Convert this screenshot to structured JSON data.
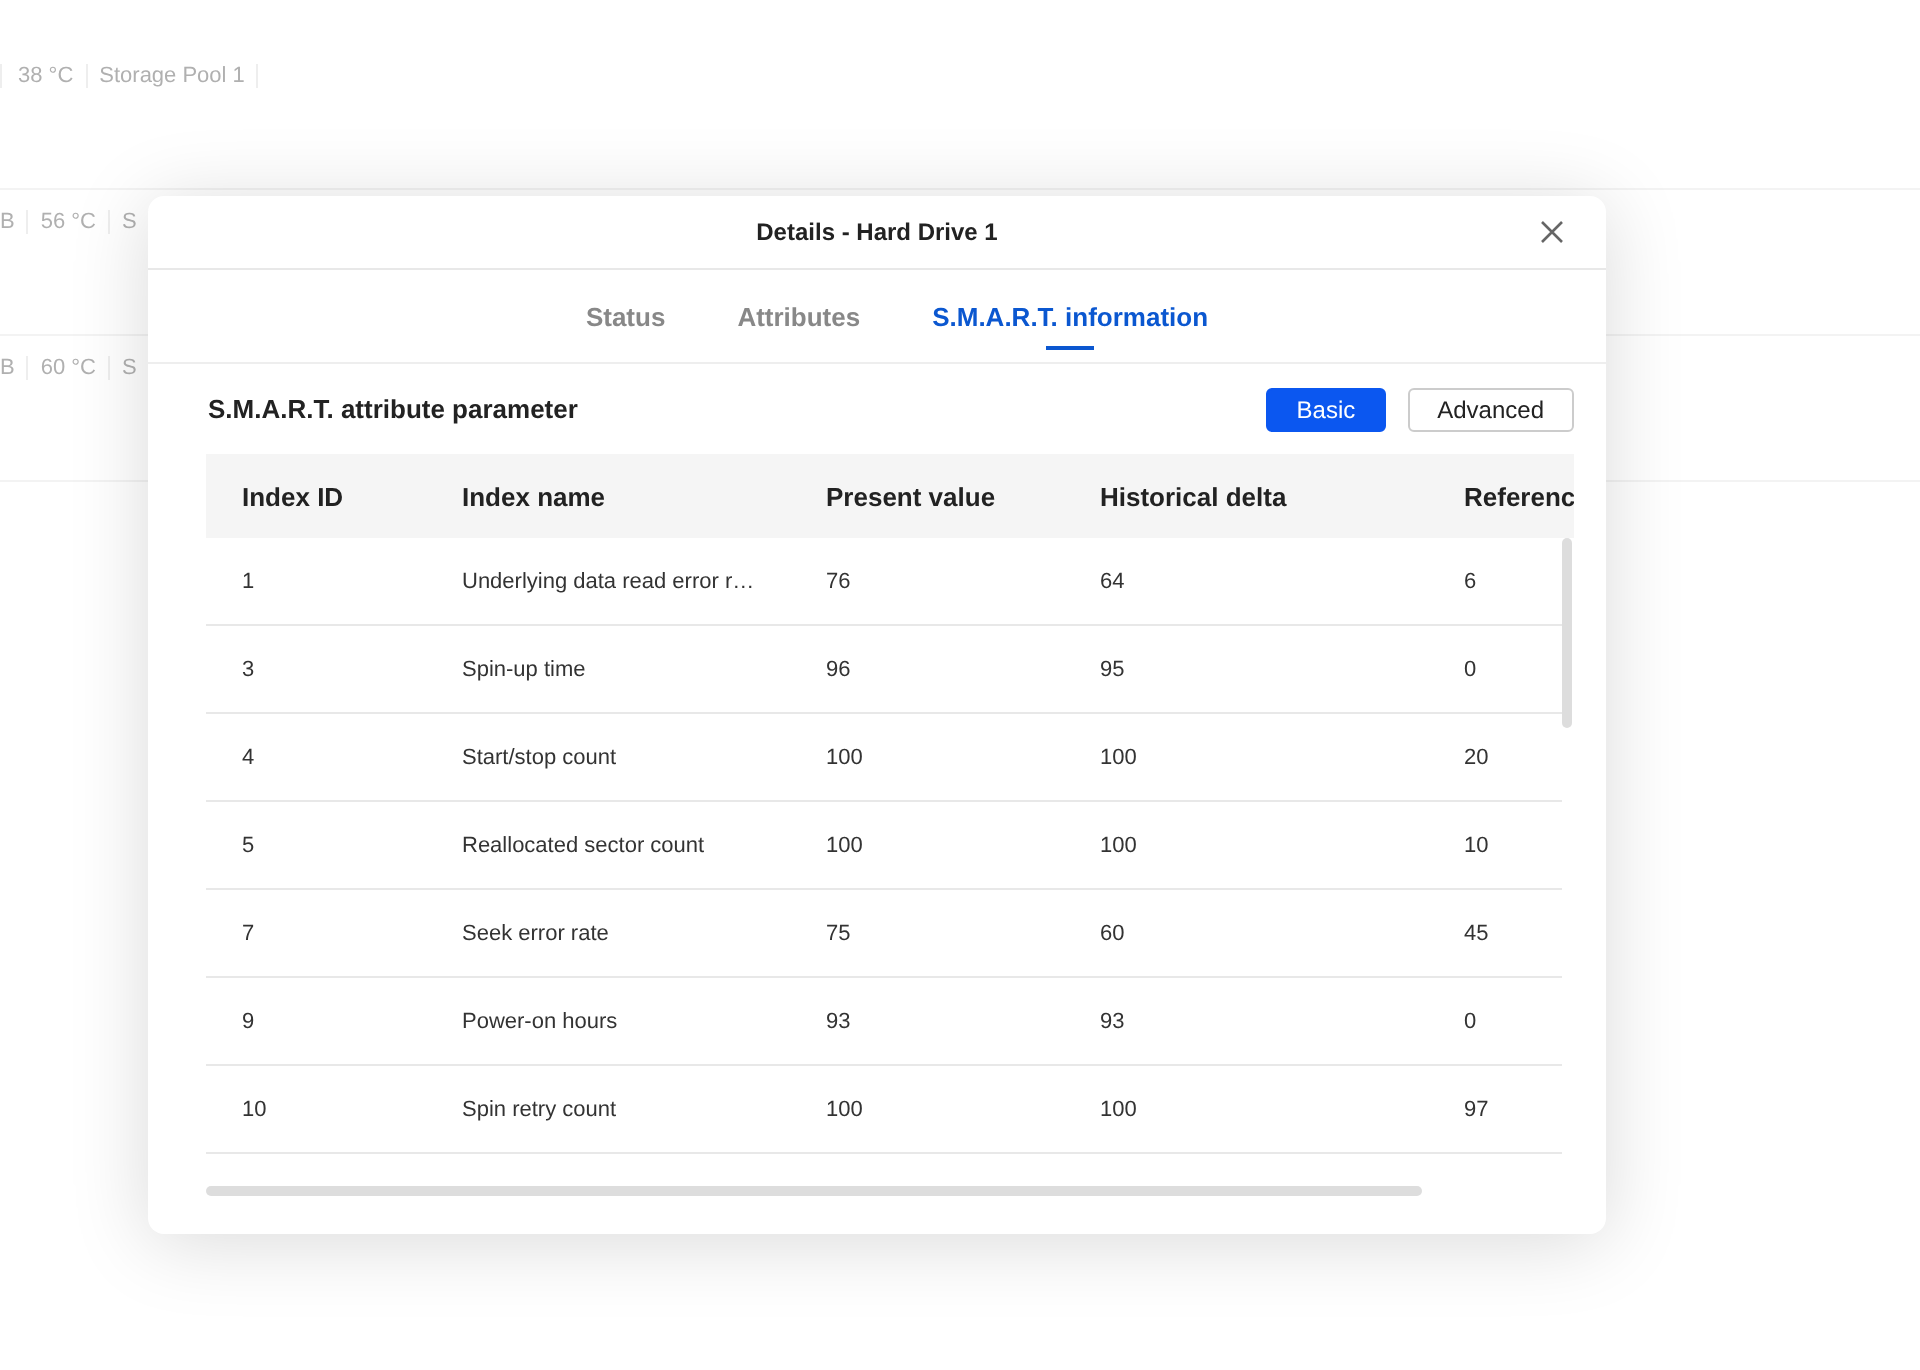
{
  "background_rows": [
    {
      "cells": [
        "38 °C",
        "Storage Pool 1"
      ]
    },
    {
      "cells": [
        "B",
        "56 °C",
        "S"
      ]
    },
    {
      "cells": [
        "B",
        "60 °C",
        "S"
      ]
    }
  ],
  "dialog": {
    "title": "Details - Hard Drive 1",
    "tabs": [
      {
        "label": "Status",
        "selected": false
      },
      {
        "label": "Attributes",
        "selected": false
      },
      {
        "label": "S.M.A.R.T. information",
        "selected": true
      }
    ],
    "section_title": "S.M.A.R.T. attribute parameter",
    "view_buttons": [
      {
        "label": "Basic",
        "selected": true
      },
      {
        "label": "Advanced",
        "selected": false
      }
    ],
    "table": {
      "columns": [
        "Index ID",
        "Index name",
        "Present value",
        "Historical delta",
        "Referenc"
      ],
      "rows": [
        [
          "1",
          "Underlying data read error r…",
          "76",
          "64",
          "6"
        ],
        [
          "3",
          "Spin-up time",
          "96",
          "95",
          "0"
        ],
        [
          "4",
          "Start/stop count",
          "100",
          "100",
          "20"
        ],
        [
          "5",
          "Reallocated sector count",
          "100",
          "100",
          "10"
        ],
        [
          "7",
          "Seek error rate",
          "75",
          "60",
          "45"
        ],
        [
          "9",
          "Power-on hours",
          "93",
          "93",
          "0"
        ],
        [
          "10",
          "Spin retry count",
          "100",
          "100",
          "97"
        ]
      ]
    }
  }
}
